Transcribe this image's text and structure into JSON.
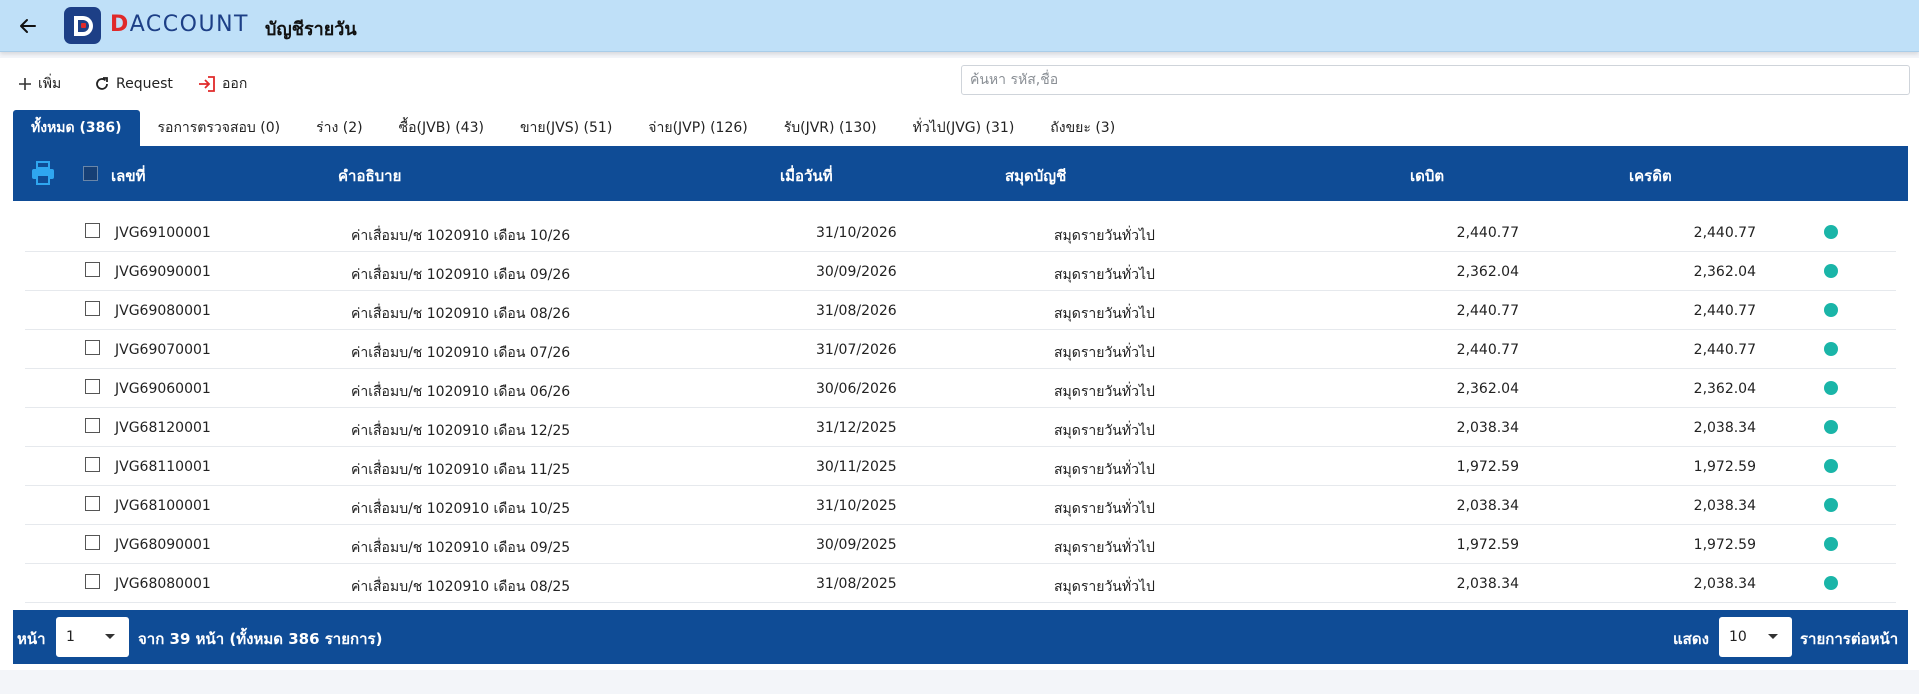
{
  "header": {
    "title": "บัญชีรายวัน",
    "brand_letter": "D",
    "brand_rest": "ACCOUNT"
  },
  "toolbar": {
    "add_label": "เพิ่ม",
    "request_label": "Request",
    "exit_label": "ออก",
    "search_placeholder": "ค้นหา รหัส,ชื่อ"
  },
  "tabs": [
    {
      "label": "ทั้งหมด (386)",
      "active": true
    },
    {
      "label": "รอการตรวจสอบ (0)",
      "active": false
    },
    {
      "label": "ร่าง (2)",
      "active": false
    },
    {
      "label": "ซื้อ(JVB) (43)",
      "active": false
    },
    {
      "label": "ขาย(JVS) (51)",
      "active": false
    },
    {
      "label": "จ่าย(JVP) (126)",
      "active": false
    },
    {
      "label": "รับ(JVR) (130)",
      "active": false
    },
    {
      "label": "ทั่วไป(JVG) (31)",
      "active": false
    },
    {
      "label": "ถังขยะ (3)",
      "active": false
    }
  ],
  "table": {
    "columns": {
      "number": "เลขที่",
      "description": "คำอธิบาย",
      "date": "เมื่อวันที่",
      "journal": "สมุดบัญชี",
      "debit": "เดบิต",
      "credit": "เครดิต"
    },
    "status_color": "#1ab5a8",
    "rows": [
      {
        "number": "JVG69100001",
        "description": "ค่าเสื่อมบ/ช 1020910 เดือน 10/26",
        "date": "31/10/2026",
        "journal": "สมุดรายวันทั่วไป",
        "debit": "2,440.77",
        "credit": "2,440.77"
      },
      {
        "number": "JVG69090001",
        "description": "ค่าเสื่อมบ/ช 1020910 เดือน 09/26",
        "date": "30/09/2026",
        "journal": "สมุดรายวันทั่วไป",
        "debit": "2,362.04",
        "credit": "2,362.04"
      },
      {
        "number": "JVG69080001",
        "description": "ค่าเสื่อมบ/ช 1020910 เดือน 08/26",
        "date": "31/08/2026",
        "journal": "สมุดรายวันทั่วไป",
        "debit": "2,440.77",
        "credit": "2,440.77"
      },
      {
        "number": "JVG69070001",
        "description": "ค่าเสื่อมบ/ช 1020910 เดือน 07/26",
        "date": "31/07/2026",
        "journal": "สมุดรายวันทั่วไป",
        "debit": "2,440.77",
        "credit": "2,440.77"
      },
      {
        "number": "JVG69060001",
        "description": "ค่าเสื่อมบ/ช 1020910 เดือน 06/26",
        "date": "30/06/2026",
        "journal": "สมุดรายวันทั่วไป",
        "debit": "2,362.04",
        "credit": "2,362.04"
      },
      {
        "number": "JVG68120001",
        "description": "ค่าเสื่อมบ/ช 1020910 เดือน 12/25",
        "date": "31/12/2025",
        "journal": "สมุดรายวันทั่วไป",
        "debit": "2,038.34",
        "credit": "2,038.34"
      },
      {
        "number": "JVG68110001",
        "description": "ค่าเสื่อมบ/ช 1020910 เดือน 11/25",
        "date": "30/11/2025",
        "journal": "สมุดรายวันทั่วไป",
        "debit": "1,972.59",
        "credit": "1,972.59"
      },
      {
        "number": "JVG68100001",
        "description": "ค่าเสื่อมบ/ช 1020910 เดือน 10/25",
        "date": "31/10/2025",
        "journal": "สมุดรายวันทั่วไป",
        "debit": "2,038.34",
        "credit": "2,038.34"
      },
      {
        "number": "JVG68090001",
        "description": "ค่าเสื่อมบ/ช 1020910 เดือน 09/25",
        "date": "30/09/2025",
        "journal": "สมุดรายวันทั่วไป",
        "debit": "1,972.59",
        "credit": "1,972.59"
      },
      {
        "number": "JVG68080001",
        "description": "ค่าเสื่อมบ/ช 1020910 เดือน 08/25",
        "date": "31/08/2025",
        "journal": "สมุดรายวันทั่วไป",
        "debit": "2,038.34",
        "credit": "2,038.34"
      }
    ]
  },
  "footer": {
    "page_label": "หน้า",
    "page_value": "1",
    "page_summary": "จาก 39 หน้า (ทั้งหมด 386 รายการ)",
    "show_label": "แสดง",
    "per_page_value": "10",
    "per_page_label": "รายการต่อหน้า"
  },
  "colors": {
    "header_bg": "#bfe0f8",
    "primary": "#0f4c96",
    "brand_red": "#e02a2a",
    "print_icon": "#2fa6f0"
  },
  "icons": [
    "back-arrow-icon",
    "logo-icon",
    "plus-icon",
    "refresh-icon",
    "exit-icon",
    "print-icon",
    "caret-down-icon",
    "status-dot-icon"
  ]
}
